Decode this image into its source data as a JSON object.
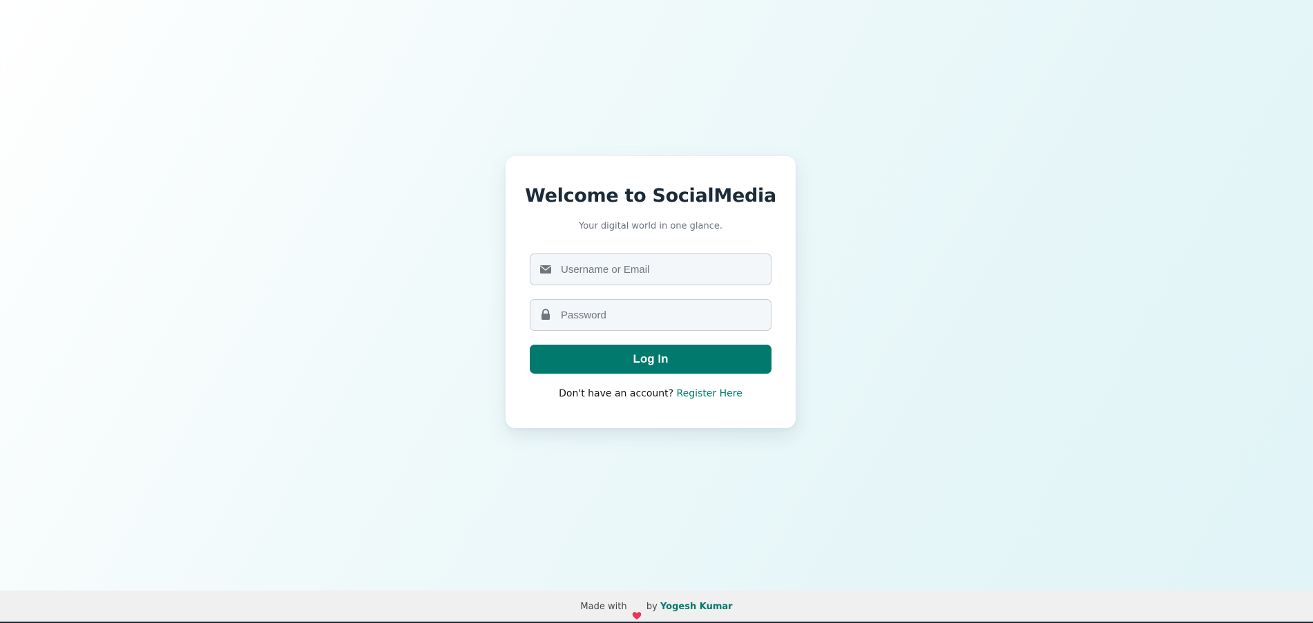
{
  "login_card": {
    "title": "Welcome to SocialMedia",
    "subtitle": "Your digital world in one glance.",
    "username_field": {
      "placeholder": "Username or Email",
      "value": "",
      "icon": "envelope-icon"
    },
    "password_field": {
      "placeholder": "Password",
      "value": "",
      "icon": "lock-icon"
    },
    "login_button_label": "Log In",
    "register_prompt": "Don't have an account?",
    "register_link": "Register Here"
  },
  "footer": {
    "made_with": "Made with",
    "heart_icon": "heart-icon",
    "by": "by",
    "author": "Yogesh Kumar"
  },
  "colors": {
    "accent": "#007a6c",
    "title": "#1c2b3a",
    "heart": "#e8365d"
  }
}
